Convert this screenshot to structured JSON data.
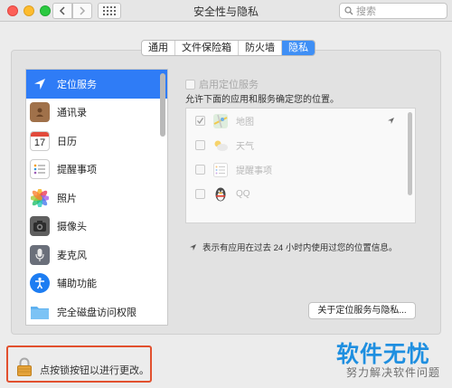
{
  "window": {
    "title": "安全性与隐私"
  },
  "toolbar": {
    "search_placeholder": "搜索"
  },
  "tabs": [
    {
      "label": "通用",
      "active": false
    },
    {
      "label": "文件保险箱",
      "active": false
    },
    {
      "label": "防火墙",
      "active": false
    },
    {
      "label": "隐私",
      "active": true
    }
  ],
  "sidebar": {
    "items": [
      {
        "label": "定位服务",
        "icon": "location-arrow-icon",
        "selected": true
      },
      {
        "label": "通讯录",
        "icon": "contacts-book-icon",
        "selected": false
      },
      {
        "label": "日历",
        "icon": "calendar-icon",
        "selected": false
      },
      {
        "label": "提醒事项",
        "icon": "reminders-icon",
        "selected": false
      },
      {
        "label": "照片",
        "icon": "photos-icon",
        "selected": false
      },
      {
        "label": "摄像头",
        "icon": "camera-icon",
        "selected": false
      },
      {
        "label": "麦克风",
        "icon": "microphone-icon",
        "selected": false
      },
      {
        "label": "辅助功能",
        "icon": "accessibility-icon",
        "selected": false
      },
      {
        "label": "完全磁盘访问权限",
        "icon": "folder-icon",
        "selected": false
      }
    ],
    "calendar_day": "17"
  },
  "location": {
    "enable_label": "启用定位服务",
    "allow_text": "允许下面的应用和服务确定您的位置。",
    "apps": [
      {
        "name": "地图",
        "checked": true,
        "icon": "maps-icon"
      },
      {
        "name": "天气",
        "checked": false,
        "icon": "weather-icon"
      },
      {
        "name": "提醒事项",
        "checked": false,
        "icon": "reminders-icon"
      },
      {
        "name": "QQ",
        "checked": false,
        "icon": "qq-penguin-icon"
      }
    ],
    "note": "表示有应用在过去 24 小时内使用过您的位置信息。",
    "about_button": "关于定位服务与隐私..."
  },
  "lock": {
    "text": "点按锁按钮以进行更改。"
  },
  "watermark": {
    "title": "软件无忧",
    "subtitle": "努力解决软件问题"
  },
  "colors": {
    "accent": "#2f7cf6",
    "tab_active": "#3f8ff5",
    "highlight_box": "#e2502e",
    "watermark": "#1f8fe0"
  }
}
